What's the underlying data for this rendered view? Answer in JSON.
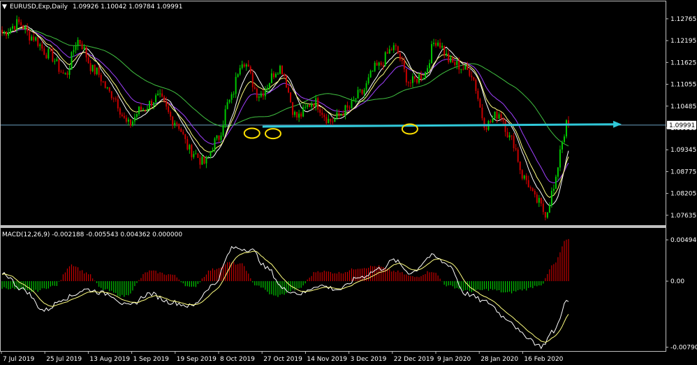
{
  "header": {
    "symbol_label": "EURUSD,Exp,Daily",
    "ohlc": "1.09926 1.10042 1.09784 1.09991",
    "macd_label": "MACD(12,26,9) -0.002188 -0.005543 0.004362 0.000000"
  },
  "colors": {
    "background": "#000000",
    "grid_border": "#c0c0c0",
    "bull": "#00c800",
    "bear": "#c80000",
    "ma_fast": "#ffff80",
    "ma_mid": "#ffffff",
    "ma_slow_purple": "#a040ff",
    "ma_long": "#40c040",
    "hline": "#6aa0c0",
    "arrow": "#30c8d8",
    "circle": "#ffe000",
    "price_box": "#ffffff"
  },
  "price_axis": {
    "ticks": [
      "1.12765",
      "1.12195",
      "1.11625",
      "1.11055",
      "1.10485",
      "1.09915",
      "1.09345",
      "1.08775",
      "1.08205",
      "1.07635"
    ],
    "current": "1.09991",
    "ylim": [
      1.0745,
      1.13
    ]
  },
  "macd_axis": {
    "ticks": [
      "0.004946",
      "0.00",
      "-0.007904"
    ],
    "ylim": [
      -0.0082,
      0.0052
    ]
  },
  "time_axis": {
    "labels": [
      "7 Jul 2019",
      "25 Jul 2019",
      "13 Aug 2019",
      "1 Sep 2019",
      "19 Sep 2019",
      "8 Oct 2019",
      "27 Oct 2019",
      "14 Nov 2019",
      "3 Dec 2019",
      "22 Dec 2019",
      "9 Jan 2020",
      "28 Jan 2020",
      "16 Feb 2020"
    ]
  },
  "chart_data": {
    "type": "candlestick",
    "series_anchors": [
      [
        0,
        1.124
      ],
      [
        8,
        1.1265
      ],
      [
        14,
        1.123
      ],
      [
        22,
        1.1185
      ],
      [
        30,
        1.113
      ],
      [
        36,
        1.122
      ],
      [
        44,
        1.114
      ],
      [
        52,
        1.108
      ],
      [
        60,
        1.1
      ],
      [
        66,
        1.104
      ],
      [
        74,
        1.107
      ],
      [
        82,
        1.101
      ],
      [
        90,
        1.093
      ],
      [
        96,
        1.09
      ],
      [
        102,
        1.096
      ],
      [
        108,
        1.106
      ],
      [
        114,
        1.117
      ],
      [
        122,
        1.108
      ],
      [
        132,
        1.115
      ],
      [
        140,
        1.102
      ],
      [
        148,
        1.106
      ],
      [
        156,
        1.101
      ],
      [
        164,
        1.104
      ],
      [
        170,
        1.108
      ],
      [
        178,
        1.115
      ],
      [
        186,
        1.12
      ],
      [
        194,
        1.111
      ],
      [
        200,
        1.113
      ],
      [
        206,
        1.122
      ],
      [
        214,
        1.116
      ],
      [
        222,
        1.114
      ],
      [
        230,
        1.1
      ],
      [
        236,
        1.103
      ],
      [
        242,
        1.096
      ],
      [
        248,
        1.086
      ],
      [
        254,
        1.08
      ],
      [
        258,
        1.077
      ],
      [
        262,
        1.083
      ],
      [
        266,
        1.096
      ],
      [
        268,
        1.0999
      ]
    ],
    "macd_anchors": [
      [
        0,
        0.001
      ],
      [
        10,
        -0.001
      ],
      [
        20,
        -0.0035
      ],
      [
        30,
        -0.002
      ],
      [
        40,
        -0.001
      ],
      [
        50,
        -0.0015
      ],
      [
        60,
        -0.003
      ],
      [
        70,
        -0.0015
      ],
      [
        80,
        -0.0025
      ],
      [
        90,
        -0.003
      ],
      [
        100,
        -0.0005
      ],
      [
        110,
        0.004
      ],
      [
        118,
        0.0038
      ],
      [
        126,
        0.0015
      ],
      [
        134,
        -0.001
      ],
      [
        142,
        -0.0015
      ],
      [
        150,
        -0.0005
      ],
      [
        160,
        -0.001
      ],
      [
        170,
        0.0005
      ],
      [
        180,
        0.0015
      ],
      [
        186,
        0.0025
      ],
      [
        194,
        0.001
      ],
      [
        204,
        0.003
      ],
      [
        212,
        0.002
      ],
      [
        220,
        -0.0015
      ],
      [
        230,
        -0.0025
      ],
      [
        240,
        -0.0045
      ],
      [
        248,
        -0.0065
      ],
      [
        256,
        -0.0078
      ],
      [
        262,
        -0.006
      ],
      [
        268,
        -0.0025
      ]
    ],
    "hist_anchors": [
      [
        0,
        -0.0008
      ],
      [
        15,
        -0.0012
      ],
      [
        25,
        -0.0006
      ],
      [
        33,
        0.002
      ],
      [
        40,
        0.001
      ],
      [
        48,
        -0.001
      ],
      [
        58,
        -0.0018
      ],
      [
        70,
        0.0012
      ],
      [
        80,
        0.0008
      ],
      [
        90,
        -0.0008
      ],
      [
        100,
        0.0014
      ],
      [
        108,
        0.0022
      ],
      [
        114,
        0.002
      ],
      [
        120,
        -0.0004
      ],
      [
        130,
        -0.0018
      ],
      [
        140,
        -0.001
      ],
      [
        150,
        0.0012
      ],
      [
        160,
        0.001
      ],
      [
        170,
        0.0016
      ],
      [
        178,
        0.0018
      ],
      [
        186,
        0.0012
      ],
      [
        196,
        0.0005
      ],
      [
        204,
        0.0012
      ],
      [
        212,
        -0.0006
      ],
      [
        222,
        -0.0012
      ],
      [
        232,
        -0.001
      ],
      [
        240,
        -0.0014
      ],
      [
        248,
        -0.001
      ],
      [
        256,
        -0.0004
      ],
      [
        262,
        0.002
      ],
      [
        268,
        0.0049
      ]
    ],
    "horizontal_line": 1.0999,
    "arrow": {
      "from": [
        124,
        1.0995
      ],
      "to": [
        270,
        1.1001
      ]
    },
    "circles": [
      [
        119,
        1.0985
      ],
      [
        129,
        1.0984
      ],
      [
        194,
        1.0996
      ]
    ]
  }
}
